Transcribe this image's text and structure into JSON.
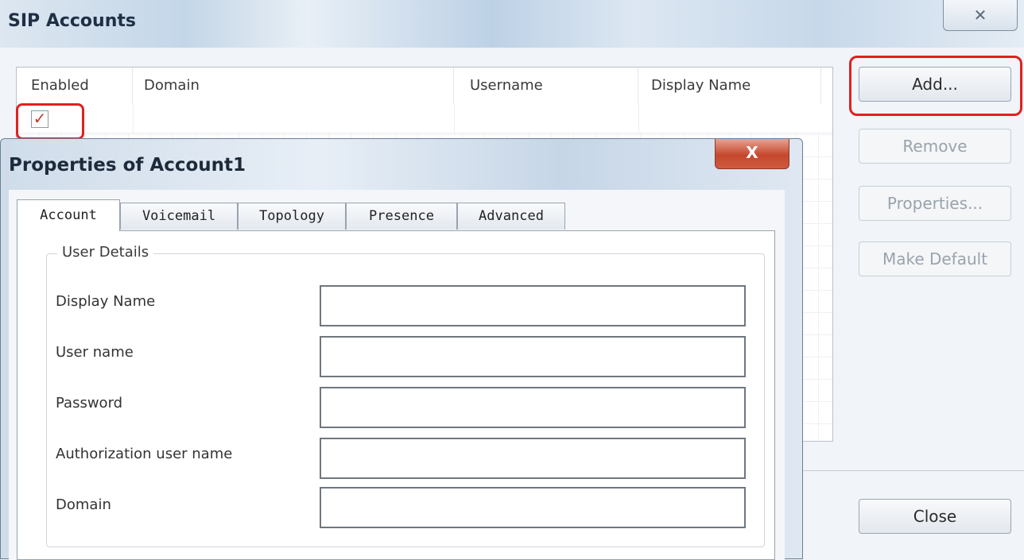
{
  "outer_window": {
    "title": "SIP Accounts",
    "close_glyph": "✕"
  },
  "accounts_table": {
    "columns": [
      "Enabled",
      "Domain",
      "Username",
      "Display Name"
    ],
    "rows": [
      {
        "enabled": true,
        "domain": "",
        "username": "",
        "display_name": ""
      }
    ],
    "checkbox_glyph": "✓"
  },
  "side_buttons": {
    "add": "Add...",
    "remove": "Remove",
    "properties": "Properties...",
    "make_default": "Make Default",
    "close": "Close"
  },
  "dialog": {
    "title": "Properties of Account1",
    "close_glyph": "X",
    "tabs": [
      "Account",
      "Voicemail",
      "Topology",
      "Presence",
      "Advanced"
    ],
    "active_tab": "Account",
    "group_title": "User Details",
    "fields": [
      {
        "label": "Display Name",
        "value": ""
      },
      {
        "label": "User name",
        "value": ""
      },
      {
        "label": "Password",
        "value": ""
      },
      {
        "label": "Authorization user name",
        "value": ""
      },
      {
        "label": "Domain",
        "value": ""
      }
    ]
  },
  "highlight_color": "#e02020"
}
